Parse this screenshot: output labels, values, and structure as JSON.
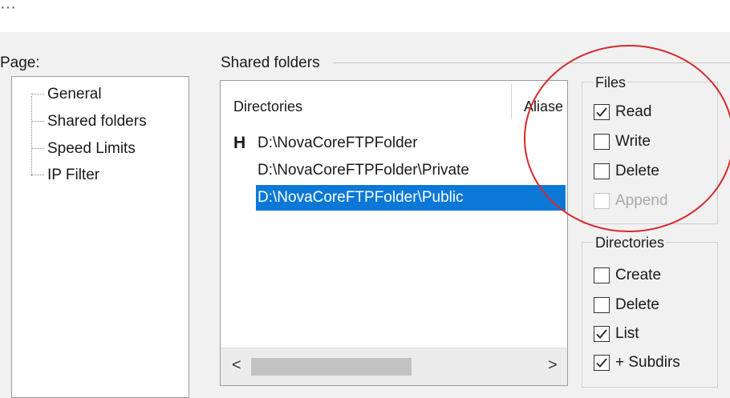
{
  "header": {
    "truncated_text": "···"
  },
  "page": {
    "label": "Page:",
    "items": [
      "General",
      "Shared folders",
      "Speed Limits",
      "IP Filter"
    ]
  },
  "shared_folders": {
    "title": "Shared folders",
    "columns": {
      "directories": "Directories",
      "aliases": "Aliase"
    },
    "rows": [
      {
        "mark": "H",
        "path": "D:\\NovaCoreFTPFolder",
        "selected": false
      },
      {
        "mark": "",
        "path": "D:\\NovaCoreFTPFolder\\Private",
        "selected": false
      },
      {
        "mark": "",
        "path": "D:\\NovaCoreFTPFolder\\Public",
        "selected": true
      }
    ],
    "scroll": {
      "left_arrow": "<",
      "right_arrow": ">"
    }
  },
  "files": {
    "title": "Files",
    "options": [
      {
        "label": "Read",
        "checked": true,
        "disabled": false
      },
      {
        "label": "Write",
        "checked": false,
        "disabled": false
      },
      {
        "label": "Delete",
        "checked": false,
        "disabled": false
      },
      {
        "label": "Append",
        "checked": false,
        "disabled": true
      }
    ]
  },
  "directories": {
    "title": "Directories",
    "options": [
      {
        "label": "Create",
        "checked": false,
        "disabled": false
      },
      {
        "label": "Delete",
        "checked": false,
        "disabled": false
      },
      {
        "label": "List",
        "checked": true,
        "disabled": false
      },
      {
        "label": "+ Subdirs",
        "checked": true,
        "disabled": false
      }
    ]
  },
  "colors": {
    "selection": "#0b78d7",
    "annotation_circle": "#d42a2a"
  }
}
